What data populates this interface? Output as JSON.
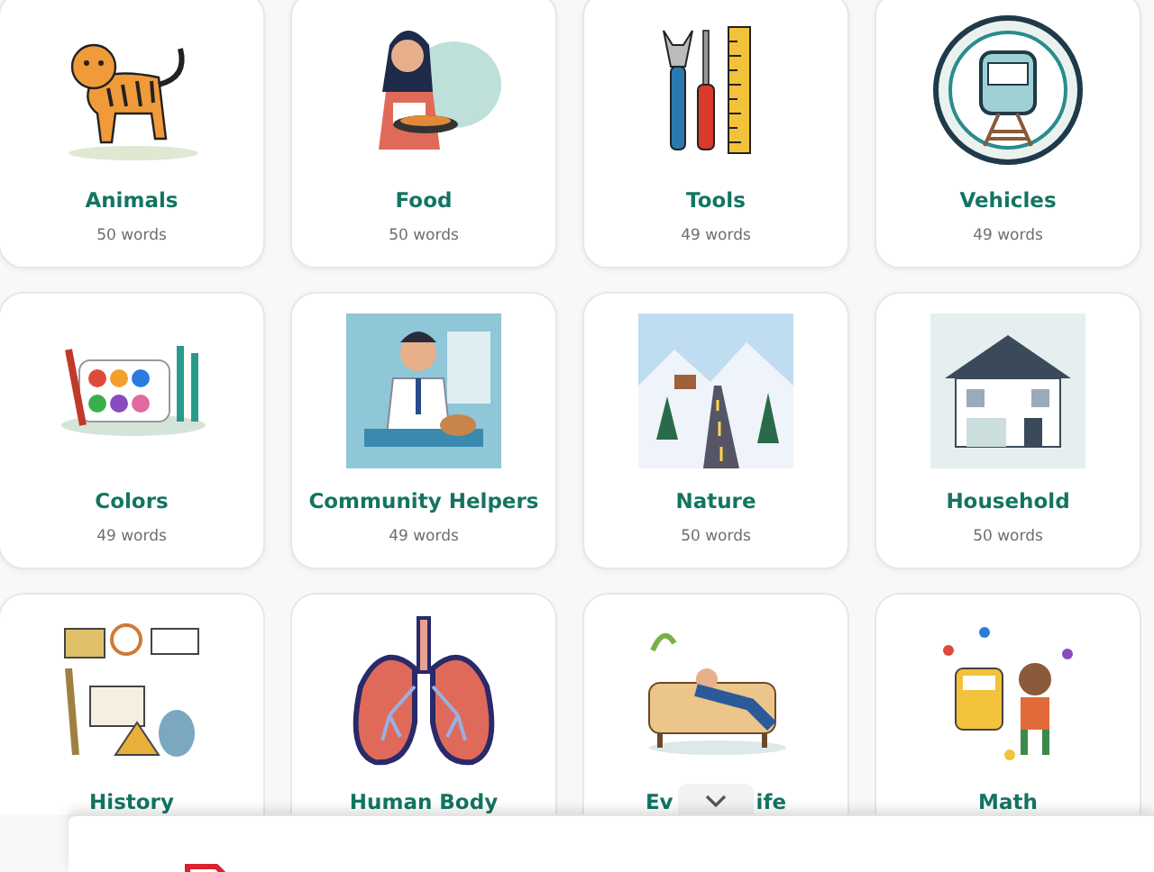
{
  "categories": [
    {
      "kind": "tiger",
      "title": "Animals",
      "count": "50 words"
    },
    {
      "kind": "cook",
      "title": "Food",
      "count": "50 words"
    },
    {
      "kind": "tools",
      "title": "Tools",
      "count": "49 words"
    },
    {
      "kind": "train",
      "title": "Vehicles",
      "count": "49 words"
    },
    {
      "kind": "paints",
      "title": "Colors",
      "count": "49 words"
    },
    {
      "kind": "doctor",
      "title": "Community Helpers",
      "count": "49 words"
    },
    {
      "kind": "road",
      "title": "Nature",
      "count": "50 words"
    },
    {
      "kind": "house",
      "title": "Household",
      "count": "50 words"
    },
    {
      "kind": "history",
      "title": "History"
    },
    {
      "kind": "lungs",
      "title": "Human Body"
    },
    {
      "kind": "sofa",
      "title": "Ev",
      "title_tail": "ife"
    },
    {
      "kind": "math",
      "title": "Math"
    }
  ]
}
